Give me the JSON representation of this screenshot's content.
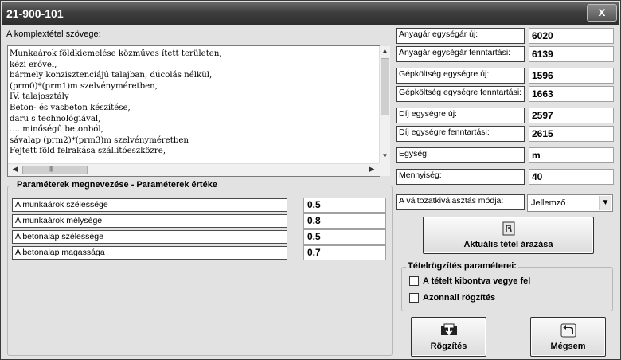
{
  "window": {
    "title": "21-900-101",
    "close_symbol": "x"
  },
  "text_section": {
    "label": "A komplextétel szövege:",
    "lines": [
      "Munkaárok földkiemelése közműves ített területen,",
      "kézi erővel,",
      "bármely konzisztenciájú talajban, dúcolás nélkül,",
      "(prm0)*(prm1)m szelvényméretben,",
      "IV. talajosztály",
      "Beton- és vasbeton készítése,",
      "daru s technológiával,",
      ".....minőségű betonból,",
      "sávalap (prm2)*(prm3)m szelvényméretben",
      "Fejtett föld felrakása szállítóeszközre,"
    ]
  },
  "parameters": {
    "title": "Paraméterek megnevezése - Paraméterek értéke",
    "rows": [
      {
        "label": "A munkaárok szélessége",
        "value": "0.5"
      },
      {
        "label": "A munkaárok mélysége",
        "value": "0.8"
      },
      {
        "label": "A betonalap szélessége",
        "value": "0.5"
      },
      {
        "label": "A betonalap magassága",
        "value": "0.7"
      }
    ]
  },
  "fields": {
    "anyagar_uj": {
      "label": "Anyagár egységár új:",
      "value": "6020"
    },
    "anyagar_fenn": {
      "label": "Anyagár egységár fenntartási:",
      "value": "6139"
    },
    "gep_uj": {
      "label": "Gépköltség egységre új:",
      "value": "1596"
    },
    "gep_fenn": {
      "label": "Gépköltség egységre fenntartási:",
      "value": "1663"
    },
    "dij_uj": {
      "label": "Díj egységre új:",
      "value": "2597"
    },
    "dij_fenn": {
      "label": "Díj egységre fenntartási:",
      "value": "2615"
    },
    "egyseg": {
      "label": "Egység:",
      "value": "m"
    },
    "mennyiseg": {
      "label": "Mennyiség:",
      "value": "40"
    },
    "valtozat": {
      "label": "A változatkiválasztás módja:",
      "value": "Jellemző"
    }
  },
  "buttons": {
    "arazas_prefix": "A",
    "arazas_rest": "ktuális tétel árazása",
    "rogzites_prefix": "R",
    "rogzites_rest": "ögzítés",
    "megsem": "Mégsem"
  },
  "rogzites_group": {
    "title": "Tételrögzítés paraméterei:",
    "kibontva": "A tételt kibontva vegye fel",
    "azonnali": "Azonnali rögzítés"
  }
}
